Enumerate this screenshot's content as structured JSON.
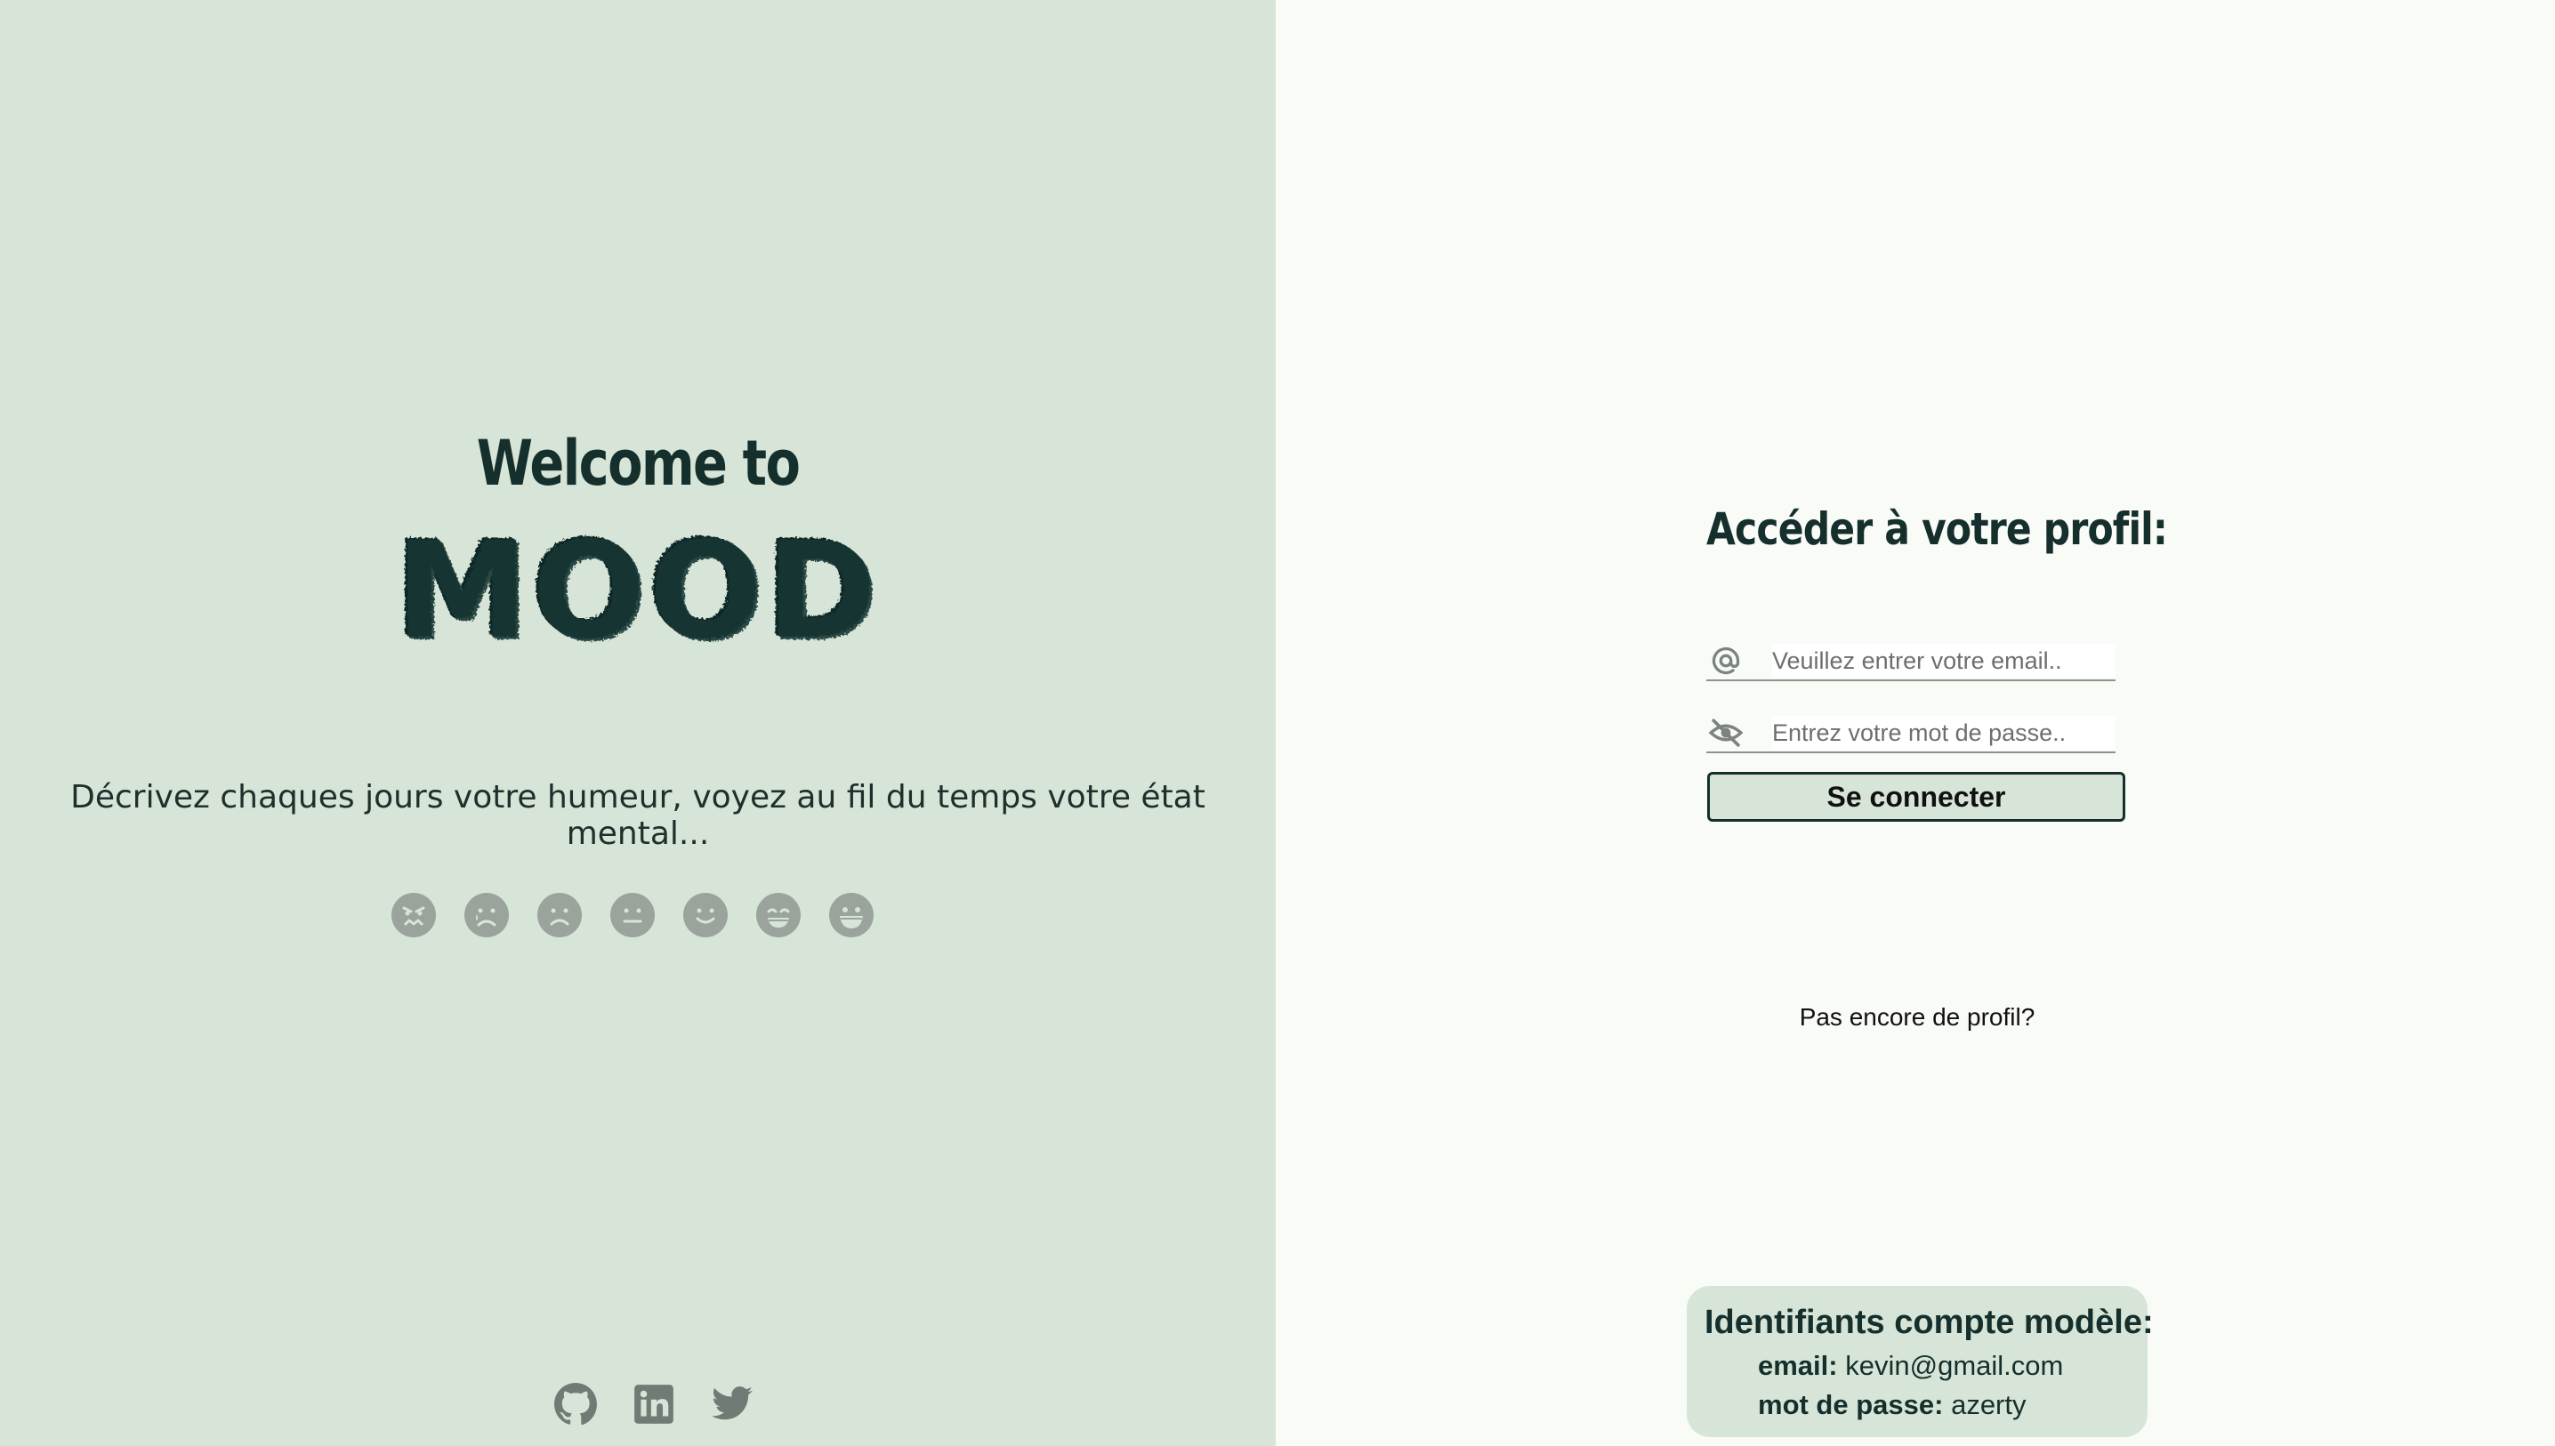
{
  "left_panel": {
    "welcome": "Welcome to",
    "brand": "MOOD",
    "tagline": "Décrivez chaques jours votre humeur, voyez au fil du temps votre état mental...",
    "mood_icons": [
      "furious-face-icon",
      "crying-face-icon",
      "sad-face-icon",
      "neutral-face-icon",
      "smile-face-icon",
      "grin-face-icon",
      "laughing-face-icon"
    ],
    "socials": [
      "github-icon",
      "linkedin-icon",
      "twitter-icon"
    ]
  },
  "login": {
    "title": "Accéder à votre profil:",
    "email_placeholder": "Veuillez entrer votre email..",
    "password_placeholder": "Entrez votre mot de passe..",
    "submit_label": "Se connecter",
    "signup_link": "Pas encore de profil?"
  },
  "demo_account": {
    "title": "Identifiants compte modèle:",
    "email_label": "email:",
    "email_value": "kevin@gmail.com",
    "password_label": "mot de passe:",
    "password_value": "azerty"
  },
  "colors": {
    "left_bg": "#d7e5d8",
    "right_bg": "#f9fbf7",
    "text_dark": "#152f2c",
    "icon_gray": "#9aa39c"
  }
}
